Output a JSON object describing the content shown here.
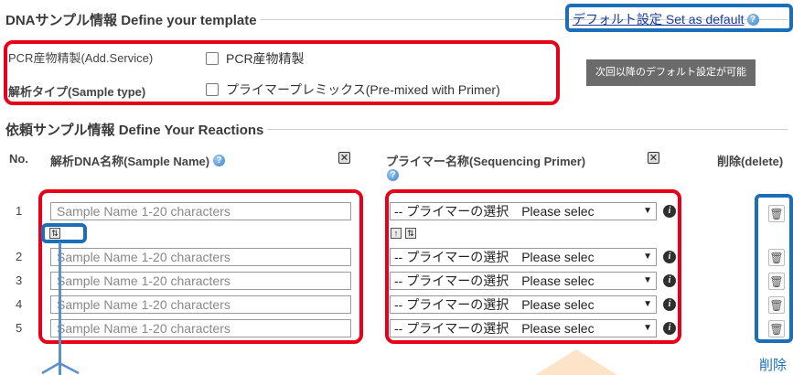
{
  "template_section": {
    "title": "DNAサンプル情報 Define your template",
    "default_link": "デフォルト設定 Set as default",
    "tooltip": "次回以降のデフォルト設定が可能",
    "pcr": {
      "label": "PCR産物精製(Add.Service)",
      "checkbox_label": "PCR産物精製"
    },
    "sample_type": {
      "label": "解析タイプ(Sample type)",
      "checkbox_label": "プライマープレミックス(Pre-mixed with Primer)"
    }
  },
  "reactions_section": {
    "title": "依頼サンプル情報 Define Your Reactions",
    "columns": {
      "no": "No.",
      "sample_name": "解析DNA名称(Sample Name)",
      "primer": "プライマー名称(Sequencing Primer)",
      "delete": "削除(delete)"
    },
    "sample_placeholder": "Sample Name 1-20 characters",
    "primer_select": "-- プライマーの選択　Please selec",
    "rows": [
      "1",
      "2",
      "3",
      "4",
      "5"
    ]
  },
  "annotations": {
    "delete_caption": "削除"
  },
  "colors": {
    "red_highlight": "#e8001b",
    "blue_highlight": "#1b6fb8",
    "orange_arrow": "#fde3c8"
  }
}
